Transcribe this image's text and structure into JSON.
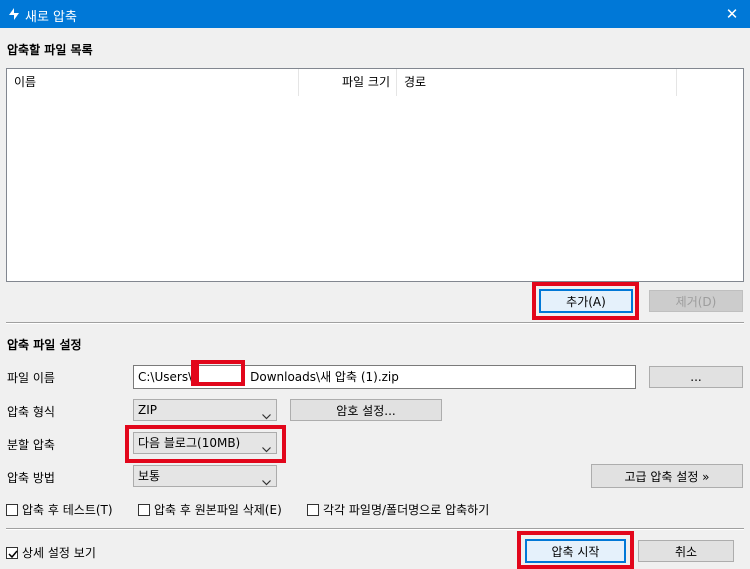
{
  "window": {
    "title": "새로 압축",
    "close_label": "✕"
  },
  "file_list": {
    "section_title": "압축할 파일 목록",
    "columns": [
      "이름",
      "파일 크기",
      "경로"
    ],
    "add_button": "추가(A)",
    "remove_button": "제거(D)"
  },
  "settings": {
    "section_title": "압축 파일 설정",
    "filename_label": "파일 이름",
    "filename_prefix": "C:\\Users\\",
    "filename_suffix": "Downloads\\새 압축 (1).zip",
    "browse_button": "...",
    "format_label": "압축 형식",
    "format_value": "ZIP",
    "password_button": "암호 설정...",
    "split_label": "분할 압축",
    "split_value": "다음 블로그(10MB)",
    "method_label": "압축 방법",
    "method_value": "보통",
    "advanced_button": "고급 압축 설정 »",
    "options": [
      {
        "label": "압축 후 테스트(T)",
        "checked": false
      },
      {
        "label": "압축 후 원본파일 삭제(E)",
        "checked": false
      },
      {
        "label": "각각 파일명/폴더명으로 압축하기",
        "checked": false
      }
    ]
  },
  "footer": {
    "show_details_label": "상세 설정 보기",
    "show_details_checked": true,
    "start_button": "압축 시작",
    "cancel_button": "취소"
  },
  "colors": {
    "titlebar": "#0078d7",
    "highlight": "#e2061b"
  }
}
